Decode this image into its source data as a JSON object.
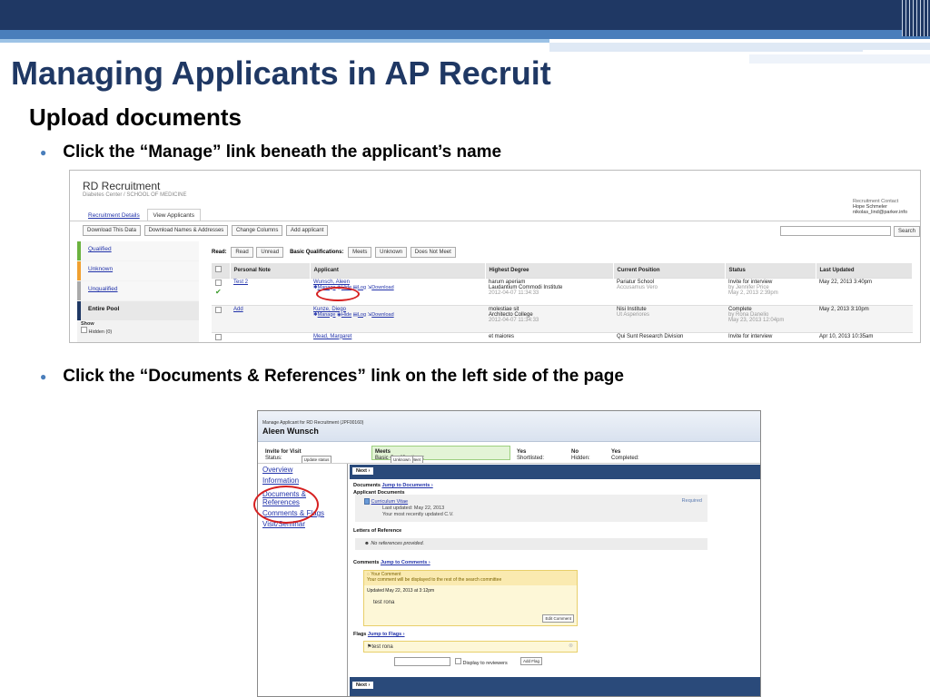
{
  "slide": {
    "title": "Managing Applicants in AP Recruit",
    "subtitle": "Upload documents",
    "bullet1": "Click the “Manage” link beneath the applicant’s name",
    "bullet2": "Click the “Documents & References” link on the left side of the page",
    "accent_color": "#1f3864"
  },
  "shot1": {
    "header": "RD Recruitment",
    "subheader": "Diabetes Center / SCHOOL OF MEDICINE",
    "contact_label": "Recruitment Contact",
    "contact_name": "Hope Schmeler",
    "contact_email": "nikolas_lind@parker.info",
    "tabs": [
      "Recruitment Details",
      "View Applicants"
    ],
    "toolbar": [
      "Download This Data",
      "Download Names & Addresses",
      "Change Columns",
      "Add applicant"
    ],
    "search_button": "Search",
    "sidebar": [
      "Qualified",
      "Unknown",
      "Unqualified",
      "Entire Pool"
    ],
    "show_label": "Show",
    "hidden_label": "Hidden (0)",
    "read_label": "Read:",
    "read_buttons": [
      "Read",
      "Unread"
    ],
    "basic_label": "Basic Qualifications:",
    "basic_buttons": [
      "Meets",
      "Unknown",
      "Does Not Meet"
    ],
    "columns": [
      "Personal Note",
      "Applicant",
      "Highest Degree",
      "Current Position",
      "Status",
      "Last Updated"
    ],
    "actions": [
      "Manage",
      "Hide",
      "Log",
      "Download"
    ],
    "rows": [
      {
        "note": "Test 2",
        "name": "Wunsch, Aleen",
        "deg1": "harum aperiam",
        "deg2": "Laudantium Commodi Institute",
        "date": "2012-04-07 11:34:33",
        "pos1": "Pariatur School",
        "pos2": "Accusamus Vero",
        "st1": "Invite for interview",
        "st2": "by Jennifer Price",
        "st3": "May 2, 2013 2:39pm",
        "updated": "May 22, 2013 3:40pm"
      },
      {
        "note": "Add",
        "name": "Kunze, Diego",
        "deg1": "molestiae sit",
        "deg2": "Architecto College",
        "date": "2012-04-07 11:34:33",
        "pos1": "Nisi Institute",
        "pos2": "Ut Asperiores",
        "st1": "Complete",
        "st2": "by Rona Danelio",
        "st3": "May 23, 2013 12:04pm",
        "updated": "May 2, 2013 3:10pm"
      },
      {
        "note": "",
        "name": "Mead, Margaret",
        "deg1": "et maiores",
        "deg2": "",
        "date": "",
        "pos1": "Qui Sunt Research Division",
        "pos2": "",
        "st1": "Invite for interview",
        "st2": "",
        "st3": "",
        "updated": "Apr 10, 2013 10:35am"
      }
    ]
  },
  "shot2": {
    "small_title": "Manage Applicant for RD Recruitment (JPF00160)",
    "name": "Aleen Wunsch",
    "status_label": "Status:",
    "status_value": "Invite for Visit",
    "update_status": "Update status",
    "basic_label": "Basic Qualifications:",
    "basic_value": "Meets",
    "dnm": "Does Not Meet",
    "unknown": "Unknown",
    "shortlisted": "Shortlisted:",
    "shortlisted_val": "Yes",
    "hidden": "Hidden:",
    "hidden_val": "No",
    "completed": "Completed:",
    "completed_val": "Yes",
    "nav": [
      "Overview",
      "Information",
      "Documents &",
      "References",
      "Comments & Flags",
      "Visit/Seminar"
    ],
    "next": "Next ›",
    "documents": "Documents",
    "jump_docs": "Jump to Documents ›",
    "applicant_docs": "Applicant Documents",
    "cv": "Curriculum Vitae",
    "cv_updated": "Last updated: May 22, 2013",
    "cv_note": "Your most recently updated C.V.",
    "required": "Required",
    "letters": "Letters of Reference",
    "no_refs": "No references provided.",
    "comments": "Comments",
    "jump_comments": "Jump to Comments ›",
    "your_comment": "Your Comment",
    "comment_note": "Your comment will be displayed to the rest of the search committee",
    "comment_updated": "Updated May 22, 2013 at 3:12pm",
    "comment_text": "test rona",
    "edit_comment": "Edit Comment",
    "flags": "Flags",
    "jump_flags": "Jump to Flags ›",
    "flag_text": "test rona",
    "display_reviewers": "Display to reviewers",
    "add_flag": "Add Flag"
  }
}
